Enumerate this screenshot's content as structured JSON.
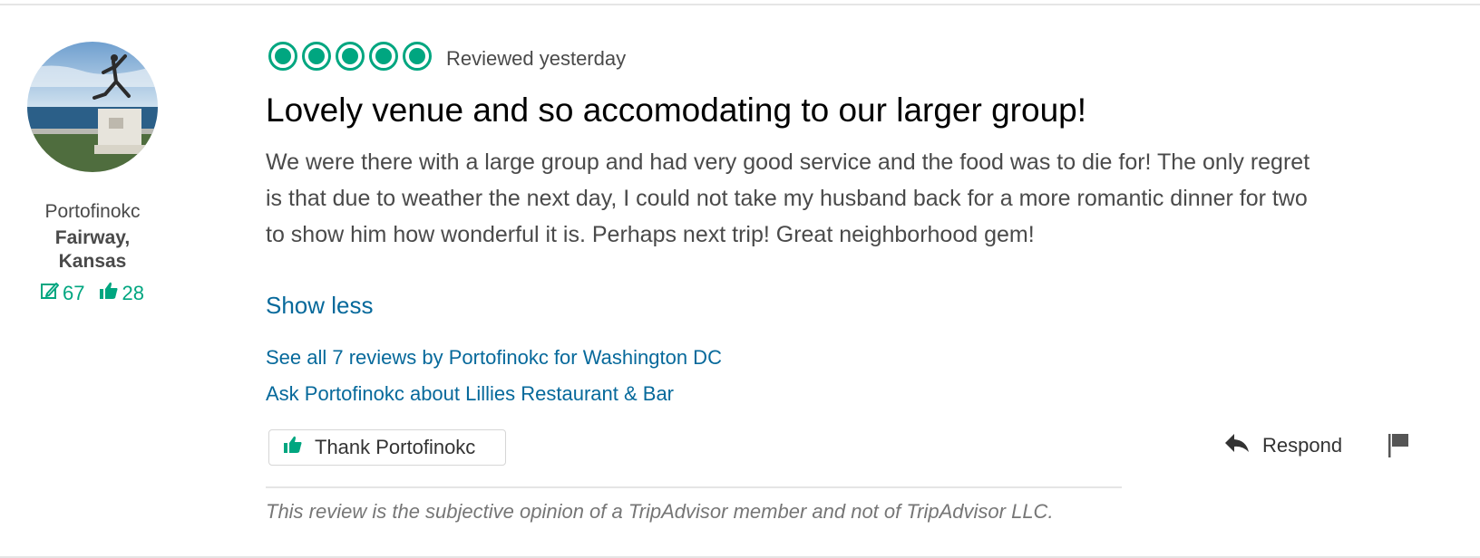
{
  "member": {
    "name": "Portofinokc",
    "location": "Fairway, Kansas",
    "review_count": "67",
    "helpful_votes": "28"
  },
  "review": {
    "rating": 5,
    "date": "Reviewed yesterday",
    "title": "Lovely venue and so accomodating to our larger group!",
    "body": "We were there with a large group and had very good service and the food was to die for! The only regret is that due to weather the next day, I could not take my husband back for a more romantic dinner for two to show him how wonderful it is. Perhaps next trip! Great neighborhood gem!",
    "show_less": "Show less",
    "see_all_link": "See all 7 reviews by Portofinokc for Washington DC",
    "ask_link": "Ask Portofinokc about Lillies Restaurant & Bar",
    "thank_button": "Thank Portofinokc",
    "respond": "Respond",
    "disclaimer": "This review is the subjective opinion of a TripAdvisor member and not of TripAdvisor LLC."
  },
  "icons": {
    "rating": "rating-bubble-icon",
    "review_count": "pencil-review-icon",
    "helpful": "thumbs-up-icon",
    "thank": "thumbs-up-icon",
    "respond": "reply-arrow-icon",
    "flag": "flag-icon"
  },
  "colors": {
    "accent": "#00a680",
    "link": "#06699b",
    "text": "#4a4a4a"
  }
}
